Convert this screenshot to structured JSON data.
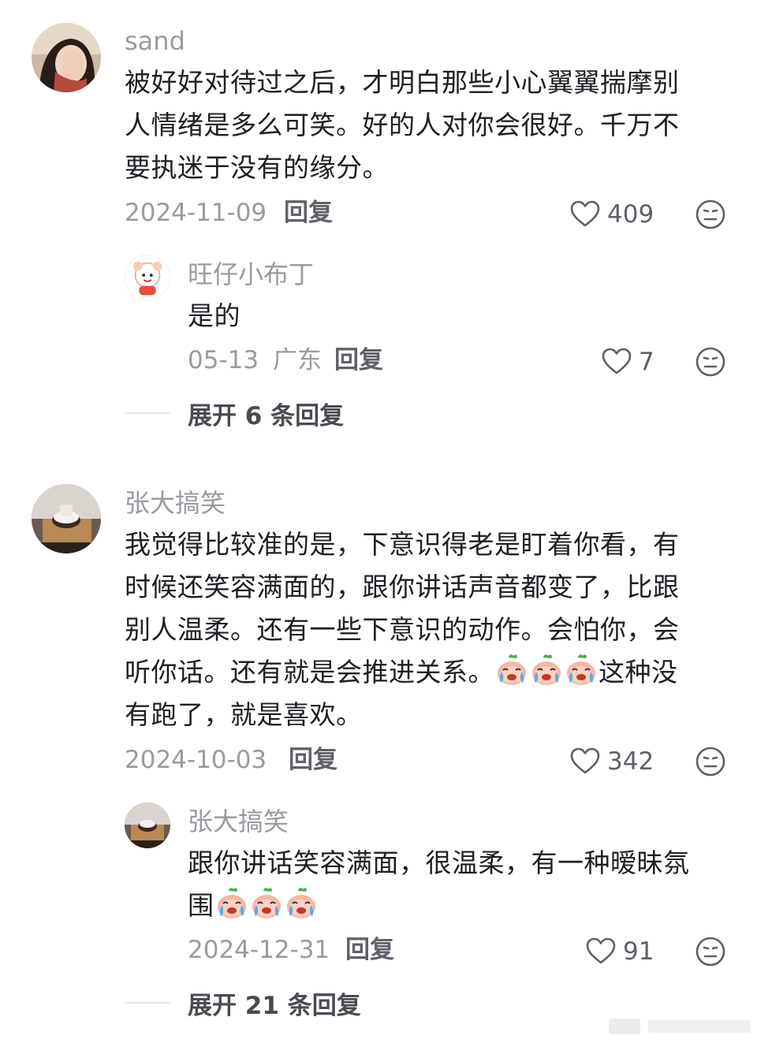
{
  "comments": [
    {
      "username": "sand",
      "lines": [
        "被好好对待过之后，才明白那些小心翼翼揣摩别",
        "人情绪是多么可笑。好的人对你会很好。千万不",
        "要执迷于没有的缘分。"
      ],
      "date": "2024-11-09",
      "reply_label": "回复",
      "likes": "409",
      "reply": {
        "username": "旺仔小布丁",
        "text": "是的",
        "date": "05-13",
        "location": "广东",
        "reply_label": "回复",
        "likes": "7"
      },
      "expand_label": "展开 6 条回复"
    },
    {
      "username": "张大搞笑",
      "lines": [
        "我觉得比较准的是，下意识得老是盯着你看，有",
        "时候还笑容满面的，跟你讲话声音都变了，比跟",
        "别人温柔。还有一些下意识的动作。会怕你，会",
        "听你话。还有就是会推进关系。",
        "有跑了，就是喜欢。"
      ],
      "line4_tail": "这种没",
      "date": "2024-10-03",
      "reply_label": "回复",
      "likes": "342",
      "reply": {
        "username": "张大搞笑",
        "lines": [
          "跟你讲话笑容满面，很温柔，有一种暧昧氛",
          "围"
        ],
        "date": "2024-12-31",
        "reply_label": "回复",
        "likes": "91"
      },
      "expand_label": "展开 21 条回复"
    }
  ],
  "icons": {
    "like": "heart-outline-icon",
    "dislike": "meh-face-icon",
    "emoji": "crying-face-emoji"
  },
  "colors": {
    "username": "#9a9ba1",
    "body_text": "#1e1f24",
    "meta": "#9a9ba1",
    "action": "#5f6068"
  }
}
